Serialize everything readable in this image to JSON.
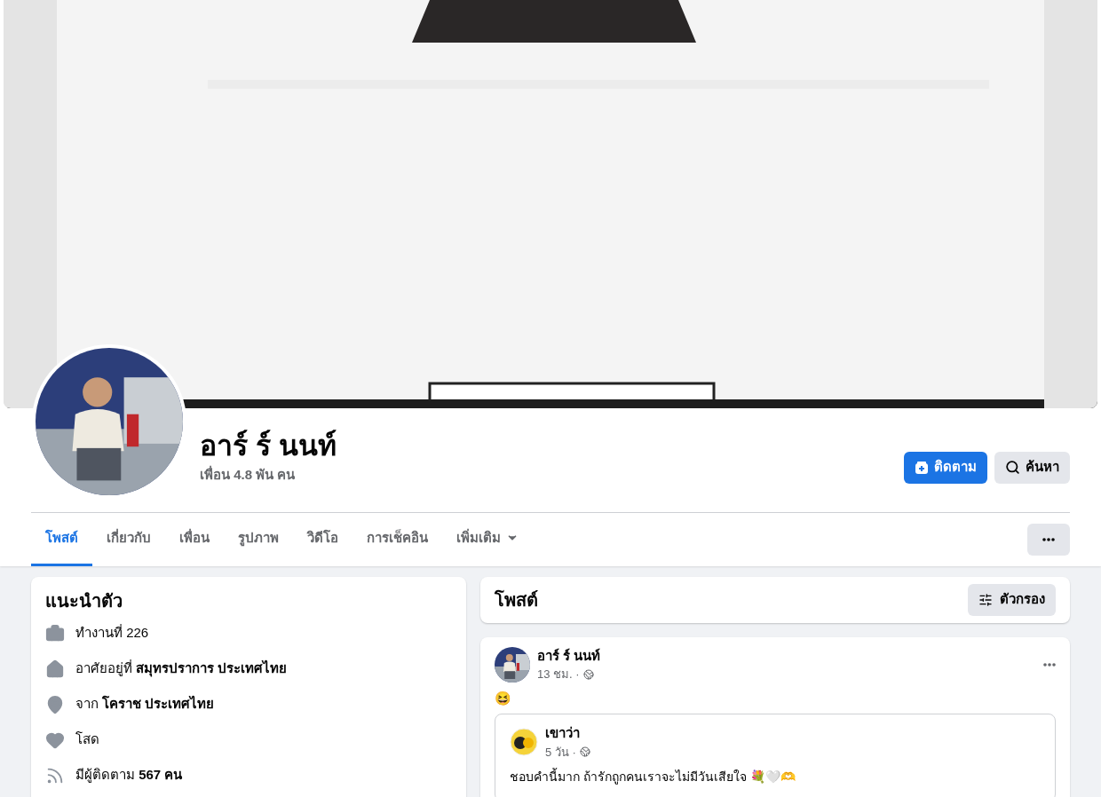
{
  "profile": {
    "name": "อาร์ ร์ นนท์",
    "friends": "เพื่อน 4.8 พัน คน"
  },
  "actions": [
    {
      "kind": "primary",
      "label": "ติดตาม"
    },
    {
      "kind": "search",
      "label": "ค้นหา"
    }
  ],
  "tabs": [
    {
      "label": "โพสต์",
      "selected": true,
      "kind": "link"
    },
    {
      "label": "เกี่ยวกับ",
      "selected": false,
      "kind": "link"
    },
    {
      "label": "เพื่อน",
      "selected": false,
      "kind": "link"
    },
    {
      "label": "รูปภาพ",
      "selected": false,
      "kind": "link"
    },
    {
      "label": "วิดีโอ",
      "selected": false,
      "kind": "link"
    },
    {
      "label": "การเช็คอิน",
      "selected": false,
      "kind": "link"
    },
    {
      "label": "เพิ่มเติม",
      "selected": false,
      "kind": "dropdown"
    }
  ],
  "intro": {
    "title": "แนะนำตัว",
    "items": [
      {
        "kind": "work",
        "text": "ทำงานที่ 226"
      },
      {
        "kind": "home",
        "text": "อาศัยอยู่ที่ **สมุทรปราการ ประเทศไทย**"
      },
      {
        "kind": "from",
        "text": "จาก **โคราช ประเทศไทย**"
      },
      {
        "kind": "relationship",
        "text": "โสด"
      },
      {
        "kind": "followers",
        "text": "มีผู้ติดตาม **567 คน**"
      }
    ]
  },
  "posts_header": {
    "title": "โพสต์",
    "filter": "ตัวกรอง"
  },
  "post": {
    "author": "อาร์ ร์ นนท์",
    "time": "13 ชม. ·",
    "text": "😆",
    "shared": {
      "author": "เขาว่า",
      "time": "5 วัน ·",
      "text": "ชอบคำนี้มาก ถ้ารักถูกคนเราจะไม่มีวันเสียใจ 💐🤍🫶"
    }
  }
}
